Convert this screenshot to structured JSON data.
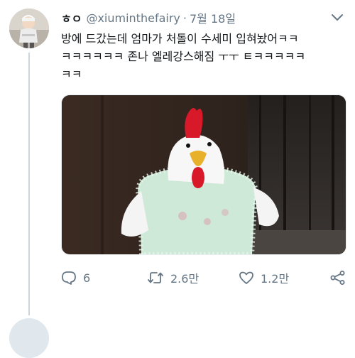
{
  "tweet": {
    "display_name": "ㅎㅇ",
    "handle": "@xiuminthefairy",
    "separator": "·",
    "date": "7월 18일",
    "text_lines": [
      "방에 드갔는데 엄마가 처돌이 수세미 입혀놨어ㅋㅋ",
      "ㅋㅋㅋㅋㅋㅋ 존나 엘레강스해짐 ㅜㅜ ㅌㅋㅋㅋㅋㅋ",
      "ㅋㅋ"
    ]
  },
  "actions": {
    "reply_count": "6",
    "retweet_count": "2.6만",
    "like_count": "1.2만"
  },
  "icons": {
    "reply": "reply-icon",
    "retweet": "retweet-icon",
    "like": "heart-icon",
    "share": "share-icon",
    "more": "chevron-down-icon"
  },
  "colors": {
    "text": "#14171a",
    "secondary": "#657786",
    "thread_line": "#ccd6dd"
  }
}
